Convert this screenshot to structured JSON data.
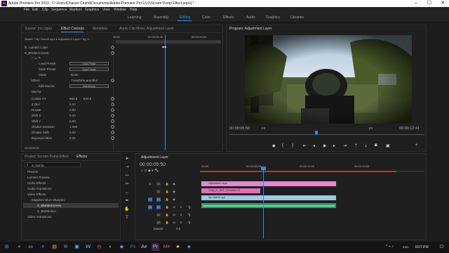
{
  "titlebar": {
    "title": "Adobe Premiere Pro 2019 - C:\\Users\\Dharani Chand\\Documents\\Adobe\\Premiere Pro\\13.0\\Screen Pump Effect.prproj *",
    "minimize": "–",
    "maximize": "☐",
    "close": "✕"
  },
  "menu": [
    "File",
    "Edit",
    "Clip",
    "Sequence",
    "Markers",
    "Graphics",
    "View",
    "Window",
    "Help"
  ],
  "workspaces": [
    "Learning",
    "Assembly",
    "Editing",
    "Color",
    "Effects",
    "Audio",
    "Graphics",
    "Libraries"
  ],
  "effect_controls": {
    "tabs": [
      "Source: (no clips)",
      "Effect Controls",
      "Metadata",
      "Audio Clip Mixer: Adjustment Layer"
    ],
    "breadcrumb": "Master * My Video5.mp4 ▸ Adjustment Layer * My V...",
    "ruler_start": "00:00",
    "ruler_mid": "00:00:05:00",
    "ruler_end": "00:00:06:00",
    "rows": {
      "fx": "fx",
      "lumetri": "Lumetri Color",
      "s_blurmocurves": "S_BlurMoCurves",
      "load_preset": "Load Preset",
      "save_preset": "Save Preset",
      "mask": "Mask",
      "mask_val": "None",
      "effect": "Effect",
      "effect_val": "Transform and Blur",
      "edit_mocha": "Edit Mocha",
      "mocha": "Mocha",
      "center_xy": "Center XY",
      "center_x": "960.0",
      "center_y": "540.0",
      "z_dist": "Z Dist",
      "z_dist_val": "0.00",
      "rotate": "Rotate",
      "rotate_val": "0.00",
      "shift_x": "Shift X",
      "shift_x_val": "0.00",
      "shift_y": "Shift Y",
      "shift_y_val": "0.00",
      "shutter_duration": "Shutter Duration",
      "shutter_duration_val": "1.000",
      "shutter_shift": "Shutter Shift",
      "shutter_shift_val": "0.00",
      "exposure_bias": "Exposure Bias",
      "exposure_bias_val": "0.00"
    },
    "timecode": "00:00:05:50"
  },
  "program": {
    "title": "Program: Adjustment Layer",
    "timecode": "00:00:05:50",
    "fit": "Fit",
    "quality": "1/4",
    "duration": "00:00:12:41"
  },
  "project": {
    "tabs": [
      "Project: Screen Pump Effect",
      "Effects"
    ],
    "search": "S_Numa",
    "tree": [
      "Presets",
      "Lumetri Presets",
      "Audio Effects",
      "Audio Transitions",
      "Video Effects",
      "Sapphire Blur+Sharpen",
      "S_BlurMoCurves",
      "S_BlurMotion",
      "Video Transitions"
    ]
  },
  "timeline": {
    "tab": "Adjustment Layer",
    "timecode": "00:00:05:50",
    "ruler": [
      "00:00",
      "00:00:05:00",
      "00:00:10:00",
      "00:00:15:00"
    ],
    "tracks": [
      "V3",
      "V2",
      "V1",
      "A1",
      "A2",
      "A3"
    ],
    "master": "Master",
    "master_val": "0.0",
    "clips": {
      "adjustment": "Adjustment Layer",
      "cuda": "Cuda_IV_OUT_Animation 01",
      "video": "My Video5.mp4"
    }
  },
  "taskbar": {
    "time": "8:07 PM",
    "lang": "ENG"
  }
}
